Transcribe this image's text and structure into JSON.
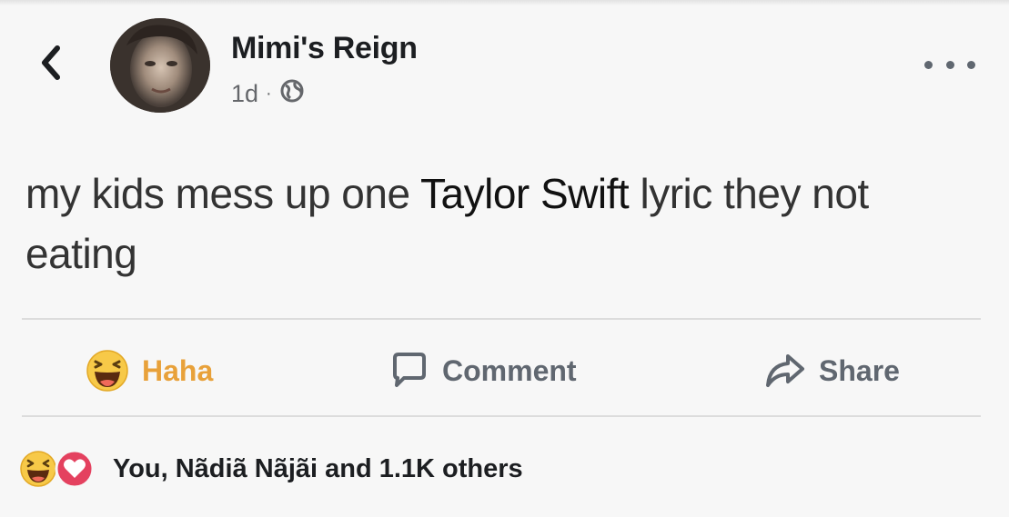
{
  "post": {
    "author": "Mimi's Reign",
    "time": "1d",
    "separator": "·",
    "text_part1": "my kids mess up one ",
    "text_highlight": "Taylor Swift",
    "text_part2": " lyric they not eating"
  },
  "actions": {
    "haha_label": "Haha",
    "comment_label": "Comment",
    "share_label": "Share"
  },
  "reactions": {
    "summary": "You, Nãdiã Nãjãi and 1.1K others"
  },
  "icons": {
    "back": "chevron-left-icon",
    "privacy": "globe-icon",
    "more": "more-options-icon",
    "haha": "haha-emoji-icon",
    "comment": "comment-bubble-icon",
    "share": "share-arrow-icon",
    "love": "love-reaction-icon"
  },
  "colors": {
    "haha_accent": "#e8a13a",
    "love_accent": "#e4415f",
    "text_muted": "#65676b"
  }
}
